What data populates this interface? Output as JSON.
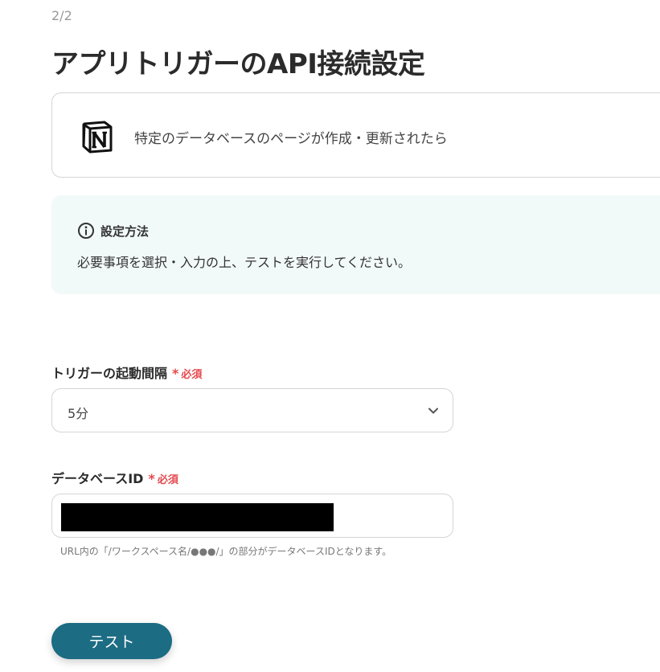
{
  "header": {
    "step": "2/2",
    "title": "アプリトリガーのAPI接続設定"
  },
  "app_card": {
    "icon": "notion-icon",
    "trigger_label": "特定のデータベースのページが作成・更新されたら"
  },
  "info": {
    "icon": "info-icon",
    "title": "設定方法",
    "text": "必要事項を選択・入力の上、テストを実行してください。"
  },
  "fields": {
    "interval": {
      "label": "トリガーの起動間隔",
      "required_mark": "*",
      "required_text": "必須",
      "value": "5分"
    },
    "database_id": {
      "label": "データベースID",
      "required_mark": "*",
      "required_text": "必須",
      "hint": "URL内の「/ワークスペース名/●●●/」の部分がデータベースIDとなります。"
    }
  },
  "actions": {
    "test_label": "テスト"
  },
  "colors": {
    "required": "#e5484d",
    "button": "#1c6c83",
    "info_bg": "#f2f9f9"
  }
}
